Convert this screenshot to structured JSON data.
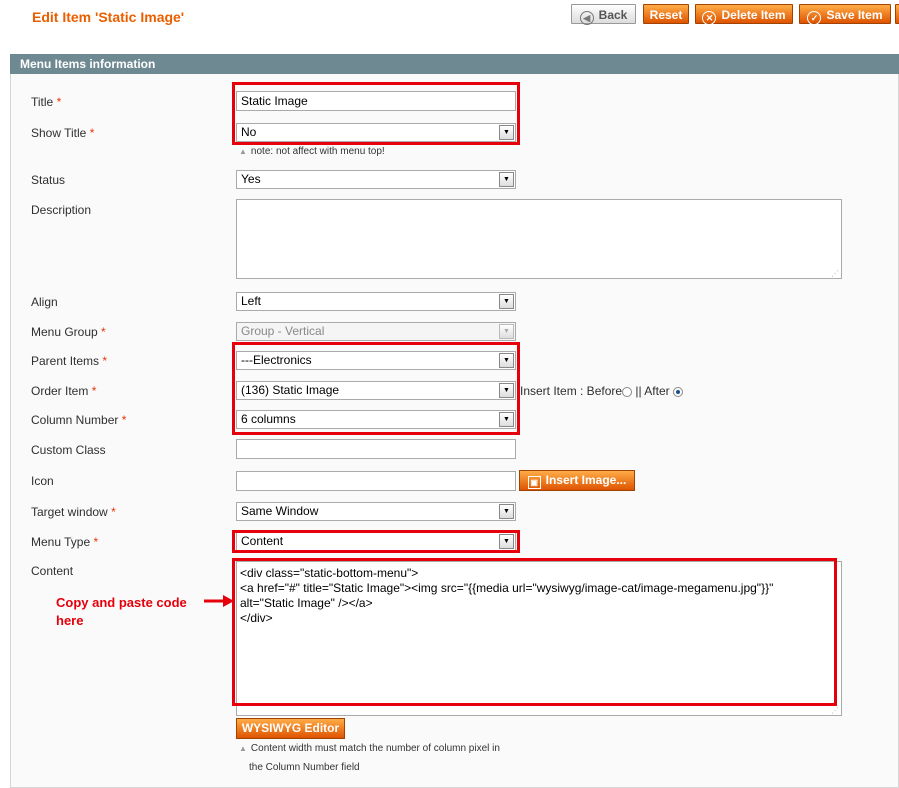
{
  "header": {
    "title": "Edit Item 'Static Image'",
    "buttons": {
      "back": "Back",
      "reset": "Reset",
      "delete": "Delete Item",
      "save": "Save Item"
    }
  },
  "section": {
    "legend": "Menu Items information"
  },
  "fields": {
    "title": {
      "label": "Title",
      "value": "Static Image"
    },
    "show_title": {
      "label": "Show Title",
      "value": "No",
      "note": "note: not affect with menu top!"
    },
    "status": {
      "label": "Status",
      "value": "Yes"
    },
    "description": {
      "label": "Description",
      "value": ""
    },
    "align": {
      "label": "Align",
      "value": "Left"
    },
    "menu_group": {
      "label": "Menu Group",
      "value": "Group - Vertical"
    },
    "parent_items": {
      "label": "Parent Items",
      "value": "---Electronics"
    },
    "order_item": {
      "label": "Order Item",
      "value": "(136) Static Image",
      "insert_label": "Insert Item : Before",
      "separator": "||",
      "after_label": "After"
    },
    "column_number": {
      "label": "Column Number",
      "value": "6 columns"
    },
    "custom_class": {
      "label": "Custom Class",
      "value": ""
    },
    "icon": {
      "label": "Icon",
      "value": "",
      "insert_button": "Insert Image..."
    },
    "target_window": {
      "label": "Target window",
      "value": "Same Window"
    },
    "menu_type": {
      "label": "Menu Type",
      "value": "Content"
    },
    "content": {
      "label": "Content",
      "lines": [
        "<div class=\"static-bottom-menu\">",
        "<a href=\"#\" title=\"Static Image\"><img src=\"{{media url=\"wysiwyg/image-cat/image-megamenu.jpg\"}}\"",
        "alt=\"Static Image\" /></a>",
        "</div>"
      ],
      "wysiwyg_button": "WYSIWYG Editor",
      "note_line1": "Content width must match the number of column pixel in",
      "note_line2": "the Column Number field"
    }
  },
  "annotation": {
    "line1": "Copy and paste code",
    "line2": "here"
  },
  "required_mark": "*",
  "colors": {
    "accent": "#eb5e00",
    "legend_bg": "#6f8992",
    "highlight": "#e5000b"
  }
}
